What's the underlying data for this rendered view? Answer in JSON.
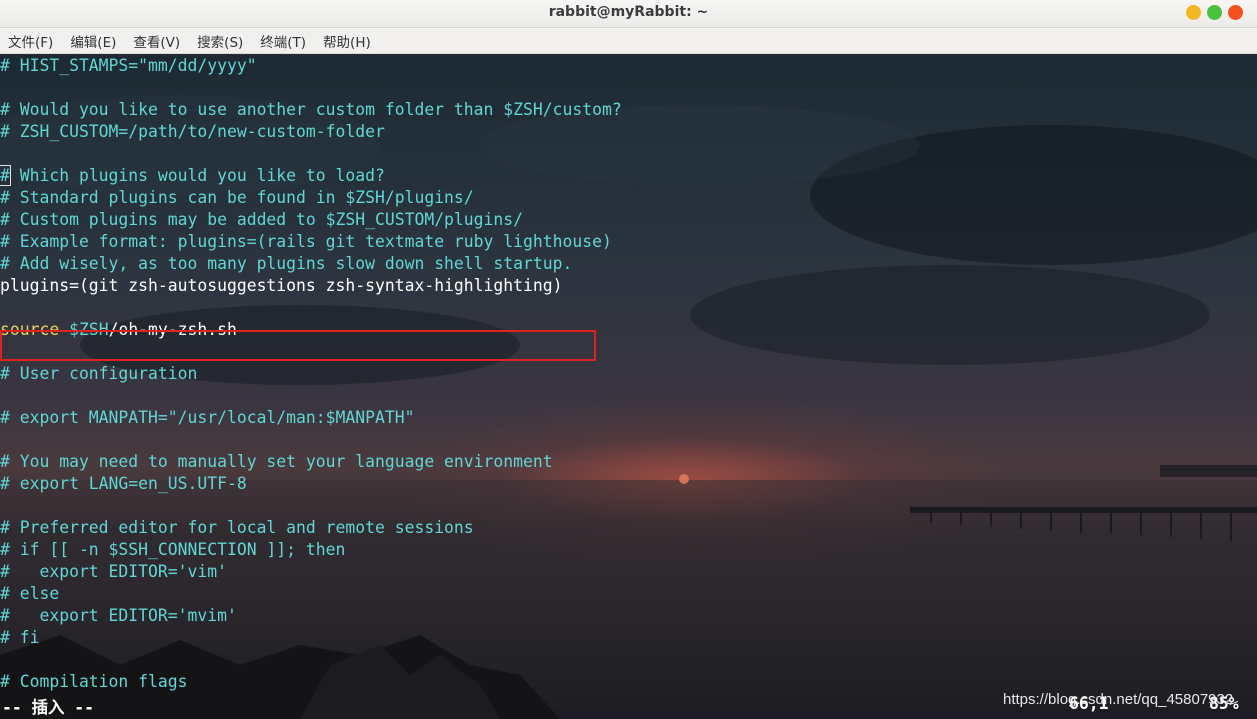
{
  "window": {
    "title": "rabbit@myRabbit: ~"
  },
  "menu": [
    "文件(F)",
    "编辑(E)",
    "查看(V)",
    "搜索(S)",
    "终端(T)",
    "帮助(H)"
  ],
  "editor": {
    "lines": [
      "# HIST_STAMPS=\"mm/dd/yyyy\"",
      "",
      "# Would you like to use another custom folder than $ZSH/custom?",
      "# ZSH_CUSTOM=/path/to/new-custom-folder",
      "",
      "# Which plugins would you like to load?",
      "# Standard plugins can be found in $ZSH/plugins/",
      "# Custom plugins may be added to $ZSH_CUSTOM/plugins/",
      "# Example format: plugins=(rails git textmate ruby lighthouse)",
      "# Add wisely, as too many plugins slow down shell startup.",
      "plugins=(git zsh-autosuggestions zsh-syntax-highlighting)",
      "",
      "source $ZSH/oh-my-zsh.sh",
      "",
      "# User configuration",
      "",
      "# export MANPATH=\"/usr/local/man:$MANPATH\"",
      "",
      "# You may need to manually set your language environment",
      "# export LANG=en_US.UTF-8",
      "",
      "# Preferred editor for local and remote sessions",
      "# if [[ -n $SSH_CONNECTION ]]; then",
      "#   export EDITOR='vim'",
      "# else",
      "#   export EDITOR='mvim'",
      "# fi",
      "",
      "# Compilation flags"
    ],
    "highlighted_line": 10,
    "cursor_line": 5
  },
  "status": {
    "mode": "-- 插入 --",
    "position": "66,1",
    "percent": "85%"
  },
  "watermark": "https://blog.csdn.net/qq_45807932"
}
